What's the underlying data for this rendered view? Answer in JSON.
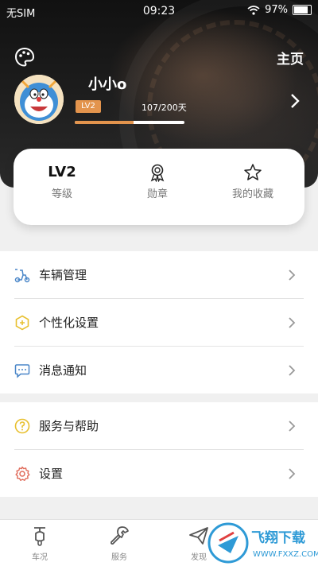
{
  "status_bar": {
    "carrier": "无SIM",
    "time": "09:23",
    "battery": "97%"
  },
  "header": {
    "home_label": "主页",
    "username": "小小o",
    "level_badge": "LV2",
    "progress_text": "107/200天",
    "progress_fraction": 0.535
  },
  "stats": [
    {
      "value": "LV2",
      "label": "等级"
    },
    {
      "icon": "medal-icon",
      "label": "勋章"
    },
    {
      "icon": "star-icon",
      "label": "我的收藏"
    }
  ],
  "menu_group_1": [
    {
      "icon": "scooter-icon",
      "label": "车辆管理"
    },
    {
      "icon": "hexagon-plus-icon",
      "label": "个性化设置"
    },
    {
      "icon": "message-icon",
      "label": "消息通知"
    }
  ],
  "menu_group_2": [
    {
      "icon": "question-icon",
      "label": "服务与帮助"
    },
    {
      "icon": "gear-icon",
      "label": "设置"
    }
  ],
  "tabs": [
    {
      "icon": "scooter-front-icon",
      "label": "车况"
    },
    {
      "icon": "wrench-icon",
      "label": "服务"
    },
    {
      "icon": "paper-plane-icon",
      "label": "发现"
    }
  ],
  "watermark_text": "飞翔下载 WWW.FXXZ.COM",
  "colors": {
    "accent": "#e3944d",
    "icon_blue": "#4a86c8",
    "icon_yellow": "#e8c02f",
    "icon_red": "#e06b5a"
  }
}
